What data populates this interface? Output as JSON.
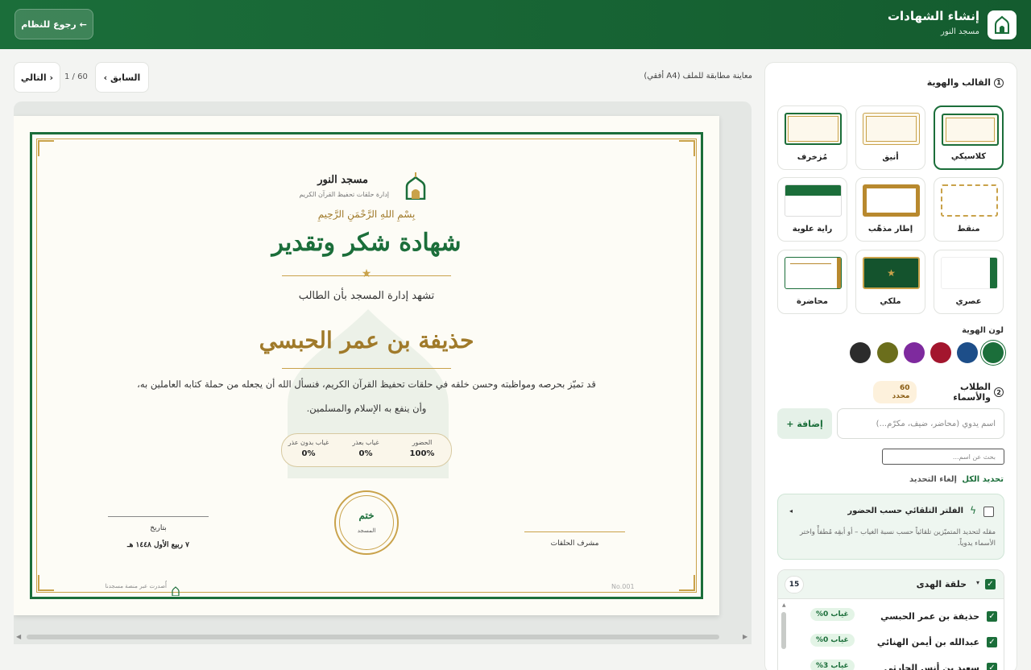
{
  "header": {
    "title": "إنشاء الشهادات",
    "subtitle": "مسجد النور",
    "back_label": "← رجوع للنظام"
  },
  "preview": {
    "label": "معاينة مطابقة للملف (A4 أفقي)",
    "prev_label": "‹ السابق",
    "next_label": "التالي ›",
    "page_counter": "1 / 60"
  },
  "certificate": {
    "org_name": "مسجد النور",
    "org_sub": "إدارة حلقات تحفيظ القرآن الكريم",
    "basmala": "بِسْمِ اللهِ الرَّحْمَنِ الرَّحِيمِ",
    "title": "شهادة شكر وتقدير",
    "intro": "تشهد إدارة المسجد بأن الطالب",
    "student_name": "حذيفة بن عمر الحبسي",
    "body_line1": "قد تميّز بحرصه ومواظبته وحسن خلقه في حلقات تحفيظ القرآن الكريم، فنسأل الله أن يجعله من حملة كتابه العاملين به،",
    "body_line2": "وأن ينفع به الإسلام والمسلمين.",
    "stats": [
      {
        "label": "الحضور",
        "value": "100%"
      },
      {
        "label": "غياب بعذر",
        "value": "0%"
      },
      {
        "label": "غياب بدون عذر",
        "value": "0%"
      }
    ],
    "seal_line1": "ختم",
    "seal_line2": "المسجد",
    "date_label": "بتاريخ",
    "date_value": "٧ ربيع الأول ١٤٤٨ هـ",
    "supervisor_label": "مشرف الحلقات",
    "serial": "No.001",
    "footer_credit": "أُصدرت عبر منصة مسجدنا"
  },
  "sidebar": {
    "template_section": "القالب والهوية",
    "section1_num": "1",
    "templates": [
      {
        "label": "كلاسيكي",
        "selected": true
      },
      {
        "label": "أنيق",
        "selected": false
      },
      {
        "label": "مُزخرف",
        "selected": false
      },
      {
        "label": "منقط",
        "selected": false
      },
      {
        "label": "إطار مذهّب",
        "selected": false
      },
      {
        "label": "راية علوية",
        "selected": false
      },
      {
        "label": "عصري",
        "selected": false
      },
      {
        "label": "ملكي",
        "selected": false
      },
      {
        "label": "محاضرة",
        "selected": false
      }
    ],
    "color_label": "لون الهوية",
    "colors": [
      "#1b6e3a",
      "#1d4e89",
      "#a3162e",
      "#7e2a9e",
      "#6b6e1c",
      "#2c2c2c"
    ],
    "students_section": "الطلاب والأسماء",
    "section2_num": "2",
    "selected_badge": "60 محدد",
    "name_placeholder": "اسم يدوي (محاضر، ضيف، مكرّم...)",
    "add_label": "+ إضافة",
    "search_placeholder": "بحث عن اسم...",
    "select_all": "تحديد الكل",
    "deselect": "إلغاء التحديد",
    "filter_title": "الفلتر التلقائي حسب الحضور",
    "filter_desc": "مقله لتحديد المتميّزين تلقائياً حسب نسبة الغياب – أو أبقِه مُطفأً واختر الأسماء يدوياً.",
    "group": {
      "name": "حلقة الهدى",
      "count": "15",
      "students": [
        {
          "name": "حذيفة بن عمر الحبسي",
          "absence": "غياب 0%"
        },
        {
          "name": "عبدالله بن أيمن الهنائي",
          "absence": "غياب 0%"
        },
        {
          "name": "سعيد بن أنس الحارثي",
          "absence": "غياب 3%"
        }
      ]
    }
  }
}
